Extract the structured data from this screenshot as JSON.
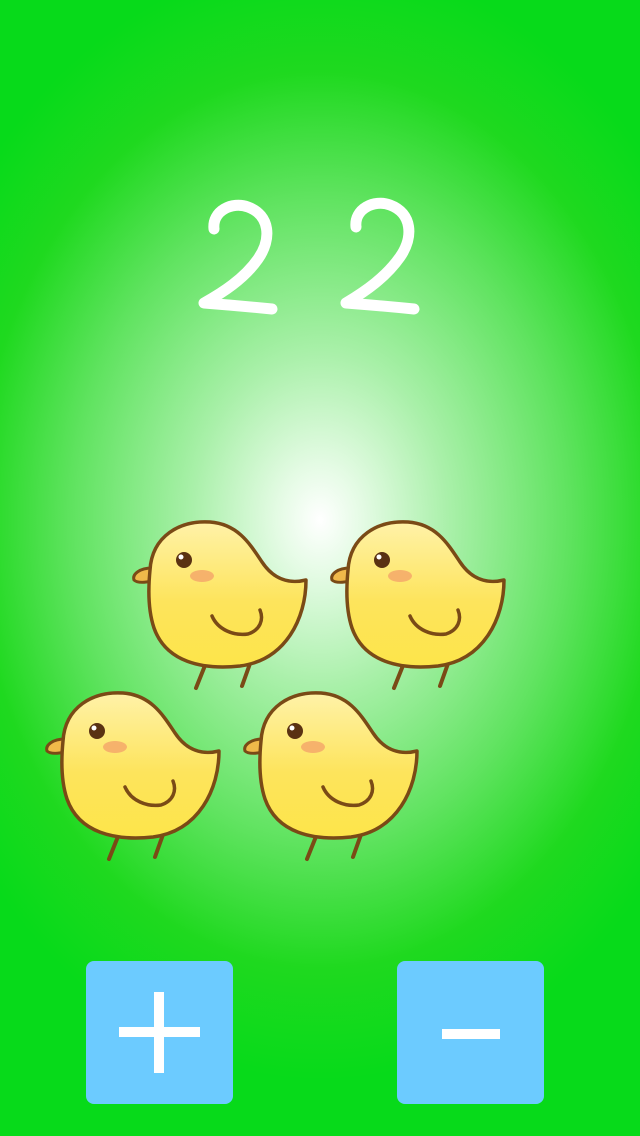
{
  "game": {
    "counter_value": "22",
    "chick_count": 4,
    "chick_icon": "chick-icon",
    "plus_icon": "plus-icon",
    "minus_icon": "minus-icon"
  },
  "colors": {
    "background_edge": "#07da1a",
    "background_center": "#ffffff",
    "button": "#6ccbff",
    "chick_body": "#fde54a",
    "chick_outline": "#7a4a16",
    "digit": "#ffffff"
  }
}
